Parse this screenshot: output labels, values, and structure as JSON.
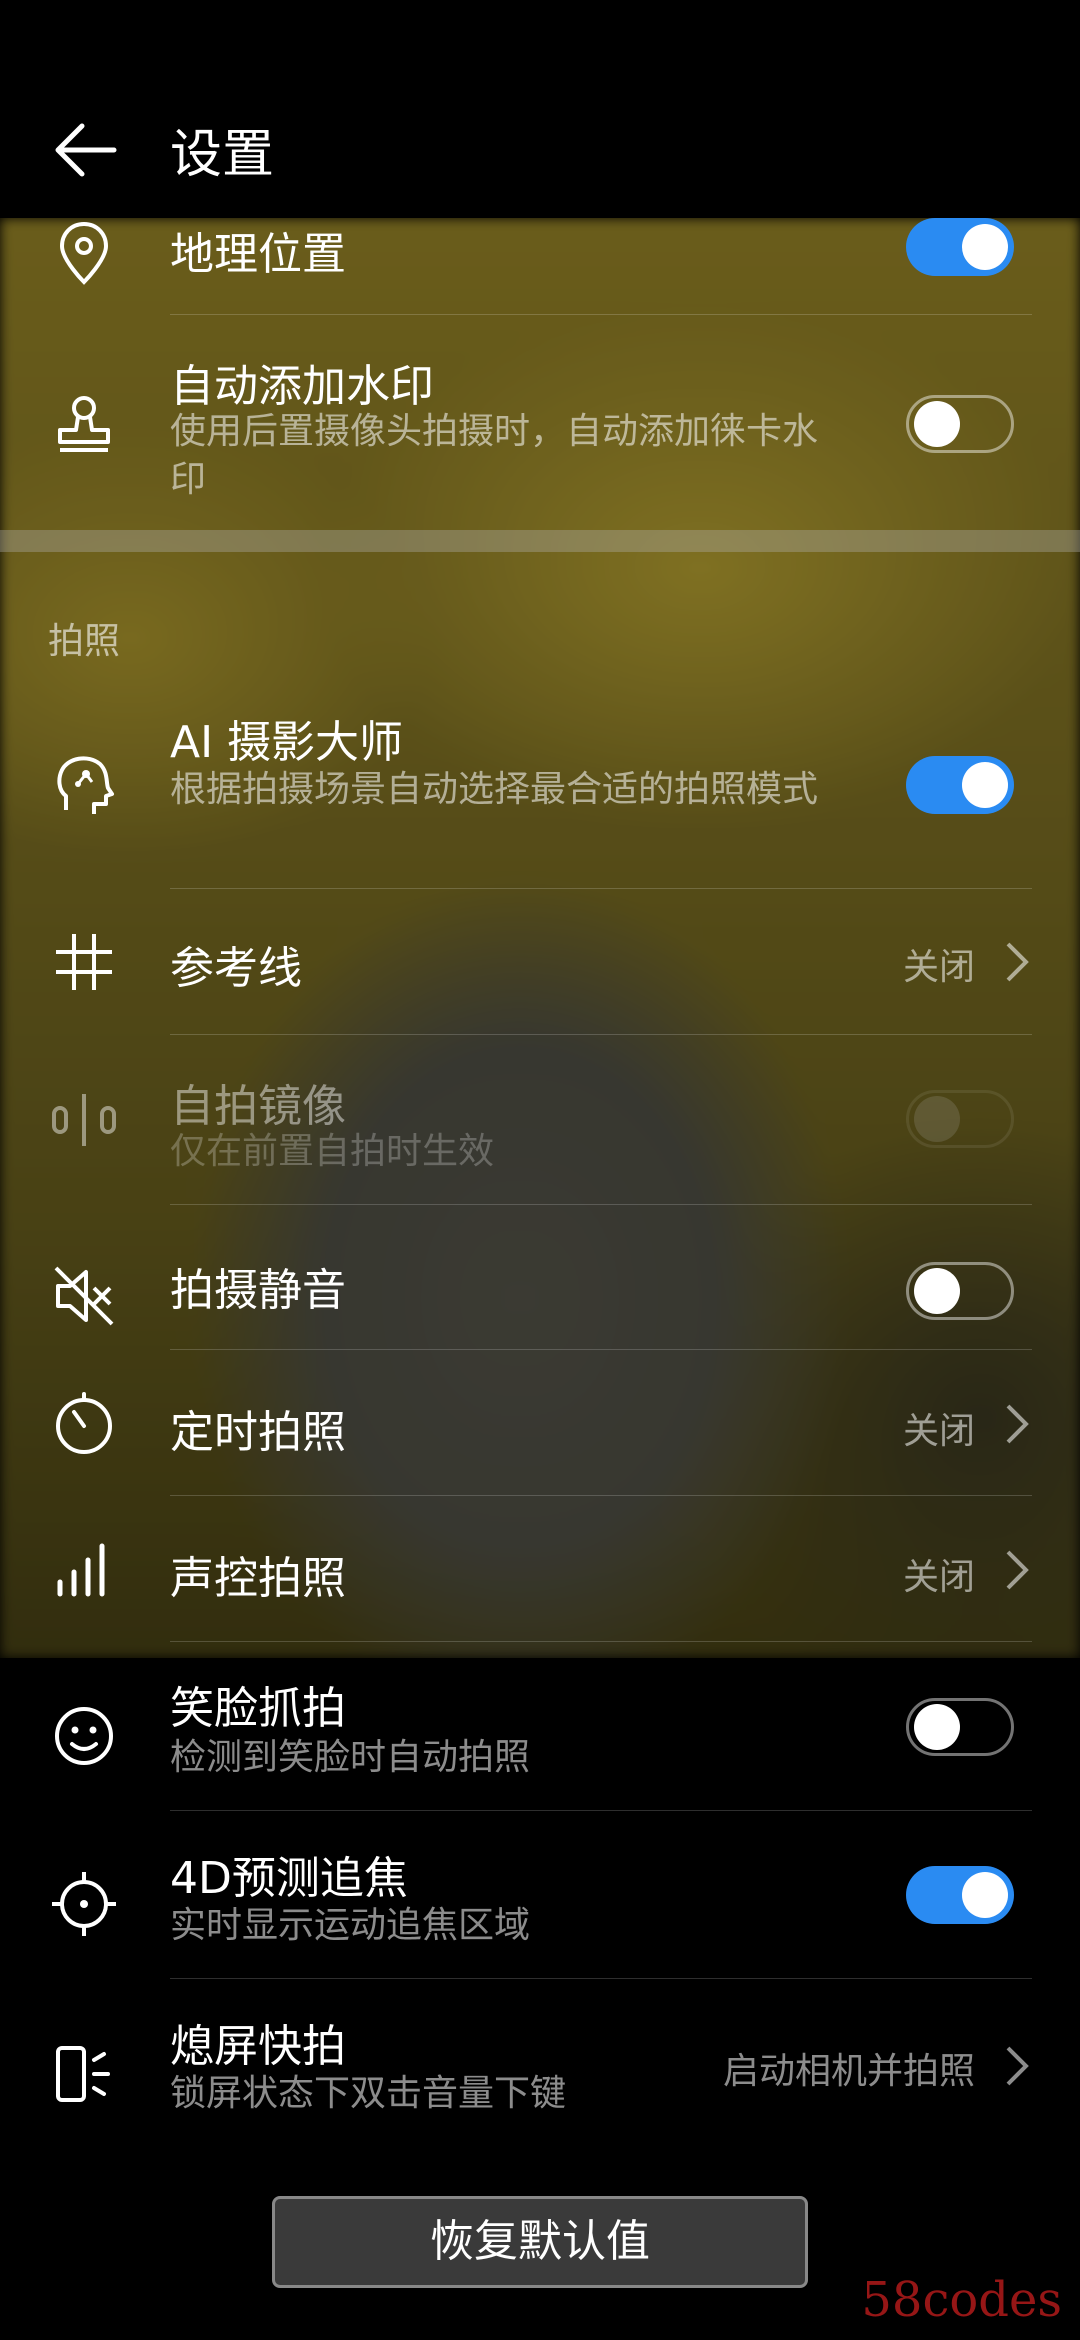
{
  "header": {
    "title": "设置"
  },
  "section_photo": {
    "title": "拍照"
  },
  "items": {
    "location": {
      "label": "地理位置",
      "toggle": "on"
    },
    "watermark": {
      "label": "自动添加水印",
      "sub": "使用后置摄像头拍摄时，自动添加徕卡水印",
      "toggle": "off"
    },
    "ai": {
      "label": "AI 摄影大师",
      "sub": "根据拍摄场景自动选择最合适的拍照模式",
      "toggle": "on"
    },
    "grid": {
      "label": "参考线",
      "value": "关闭"
    },
    "mirror": {
      "label": "自拍镜像",
      "sub": "仅在前置自拍时生效",
      "toggle": "off-disabled"
    },
    "mute": {
      "label": "拍摄静音",
      "toggle": "off"
    },
    "timer": {
      "label": "定时拍照",
      "value": "关闭"
    },
    "voice": {
      "label": "声控拍照",
      "value": "关闭"
    },
    "smile": {
      "label": "笑脸抓拍",
      "sub": "检测到笑脸时自动拍照",
      "toggle": "off"
    },
    "focus": {
      "label": "4D预测追焦",
      "sub": "实时显示运动追焦区域",
      "toggle": "on"
    },
    "quicksnap": {
      "label": "熄屏快拍",
      "sub": "锁屏状态下双击音量下键",
      "value": "启动相机并拍照"
    }
  },
  "reset_label": "恢复默认值",
  "watermark_text": "58codes",
  "colors": {
    "accent": "#2a8bf2",
    "background": "#000000"
  }
}
